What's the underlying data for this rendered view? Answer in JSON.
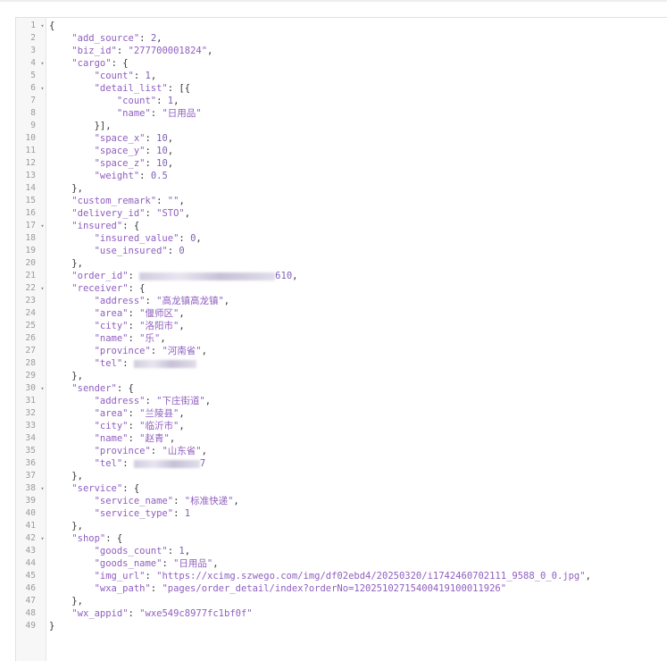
{
  "json_lines": [
    {
      "ln": "1",
      "fold": true,
      "text": "{"
    },
    {
      "ln": "2",
      "fold": false,
      "text": "    \"add_source\": 2,"
    },
    {
      "ln": "3",
      "fold": false,
      "text": "    \"biz_id\": \"277700001824\","
    },
    {
      "ln": "4",
      "fold": true,
      "text": "    \"cargo\": {"
    },
    {
      "ln": "5",
      "fold": false,
      "text": "        \"count\": 1,"
    },
    {
      "ln": "6",
      "fold": true,
      "text": "        \"detail_list\": [{"
    },
    {
      "ln": "7",
      "fold": false,
      "text": "            \"count\": 1,"
    },
    {
      "ln": "8",
      "fold": false,
      "text": "            \"name\": \"日用品\""
    },
    {
      "ln": "9",
      "fold": false,
      "text": "        }],"
    },
    {
      "ln": "10",
      "fold": false,
      "text": "        \"space_x\": 10,"
    },
    {
      "ln": "11",
      "fold": false,
      "text": "        \"space_y\": 10,"
    },
    {
      "ln": "12",
      "fold": false,
      "text": "        \"space_z\": 10,"
    },
    {
      "ln": "13",
      "fold": false,
      "text": "        \"weight\": 0.5"
    },
    {
      "ln": "14",
      "fold": false,
      "text": "    },"
    },
    {
      "ln": "15",
      "fold": false,
      "text": "    \"custom_remark\": \"\","
    },
    {
      "ln": "16",
      "fold": false,
      "text": "    \"delivery_id\": \"STO\","
    },
    {
      "ln": "17",
      "fold": true,
      "text": "    \"insured\": {"
    },
    {
      "ln": "18",
      "fold": false,
      "text": "        \"insured_value\": 0,"
    },
    {
      "ln": "19",
      "fold": false,
      "text": "        \"use_insured\": 0"
    },
    {
      "ln": "20",
      "fold": false,
      "text": "    },"
    },
    {
      "ln": "21",
      "fold": false,
      "text": "    \"order_id\": \"",
      "blur": 1,
      "after": "610\","
    },
    {
      "ln": "22",
      "fold": true,
      "text": "    \"receiver\": {"
    },
    {
      "ln": "23",
      "fold": false,
      "text": "        \"address\": \"高龙镇高龙镇\","
    },
    {
      "ln": "24",
      "fold": false,
      "text": "        \"area\": \"偃师区\","
    },
    {
      "ln": "25",
      "fold": false,
      "text": "        \"city\": \"洛阳市\","
    },
    {
      "ln": "26",
      "fold": false,
      "text": "        \"name\": \"乐\","
    },
    {
      "ln": "27",
      "fold": false,
      "text": "        \"province\": \"河南省\","
    },
    {
      "ln": "28",
      "fold": false,
      "text": "        \"tel\": \"",
      "blur": 2,
      "after": "\""
    },
    {
      "ln": "29",
      "fold": false,
      "text": "    },"
    },
    {
      "ln": "30",
      "fold": true,
      "text": "    \"sender\": {"
    },
    {
      "ln": "31",
      "fold": false,
      "text": "        \"address\": \"下庄街道\","
    },
    {
      "ln": "32",
      "fold": false,
      "text": "        \"area\": \"兰陵县\","
    },
    {
      "ln": "33",
      "fold": false,
      "text": "        \"city\": \"临沂市\","
    },
    {
      "ln": "34",
      "fold": false,
      "text": "        \"name\": \"赵青\","
    },
    {
      "ln": "35",
      "fold": false,
      "text": "        \"province\": \"山东省\","
    },
    {
      "ln": "36",
      "fold": false,
      "text": "        \"tel\": \"",
      "blur": 3,
      "after": "7\""
    },
    {
      "ln": "37",
      "fold": false,
      "text": "    },"
    },
    {
      "ln": "38",
      "fold": true,
      "text": "    \"service\": {"
    },
    {
      "ln": "39",
      "fold": false,
      "text": "        \"service_name\": \"标准快递\","
    },
    {
      "ln": "40",
      "fold": false,
      "text": "        \"service_type\": 1"
    },
    {
      "ln": "41",
      "fold": false,
      "text": "    },"
    },
    {
      "ln": "42",
      "fold": true,
      "text": "    \"shop\": {"
    },
    {
      "ln": "43",
      "fold": false,
      "text": "        \"goods_count\": 1,"
    },
    {
      "ln": "44",
      "fold": false,
      "text": "        \"goods_name\": \"日用品\","
    },
    {
      "ln": "45",
      "fold": false,
      "text": "        \"img_url\": \"https://xcimg.szwego.com/img/df02ebd4/20250320/i1742460702111_9588_0_0.jpg\","
    },
    {
      "ln": "46",
      "fold": false,
      "text": "        \"wxa_path\": \"pages/order_detail/index?orderNo=12025102715400419100011926\""
    },
    {
      "ln": "47",
      "fold": false,
      "text": "    },"
    },
    {
      "ln": "48",
      "fold": false,
      "text": "    \"wx_appid\": \"wxe549c8977fc1bf0f\""
    },
    {
      "ln": "49",
      "fold": false,
      "text": "}"
    }
  ],
  "fold_glyph": "▾",
  "colors": {
    "key": "#8f5fbf",
    "string": "#8f5fbf",
    "number": "#7f5fb5",
    "punct": "#333333"
  }
}
